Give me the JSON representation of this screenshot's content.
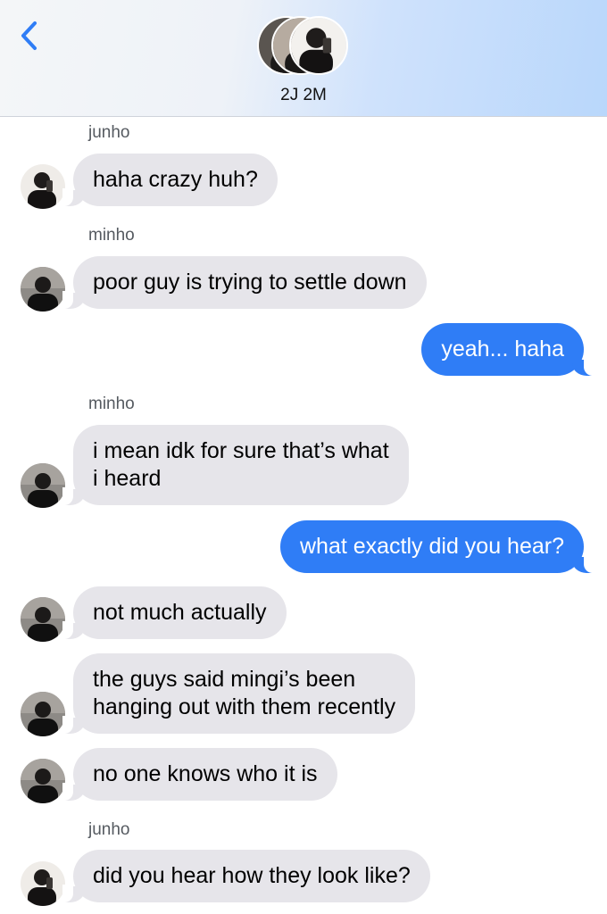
{
  "header": {
    "back_icon": "chevron-left-icon",
    "group_name": "2J 2M",
    "accent_color": "#2f7df6"
  },
  "messages": [
    {
      "sender": "junho",
      "text": "haha crazy huh?",
      "direction": "incoming"
    },
    {
      "sender": "minho",
      "text": "poor guy is trying to settle down",
      "direction": "incoming"
    },
    {
      "text": "yeah... haha",
      "direction": "outgoing"
    },
    {
      "sender": "minho",
      "lines": [
        "i mean idk for sure that’s what",
        "i heard"
      ],
      "direction": "incoming"
    },
    {
      "text": "what exactly did you hear?",
      "direction": "outgoing"
    },
    {
      "text": "not much actually",
      "direction": "incoming"
    },
    {
      "lines": [
        "the guys said mingi’s been",
        "hanging out with them recently"
      ],
      "direction": "incoming"
    },
    {
      "text": "no one knows who it is",
      "direction": "incoming"
    },
    {
      "sender": "junho",
      "text": "did you hear how they look like?",
      "direction": "incoming"
    }
  ]
}
